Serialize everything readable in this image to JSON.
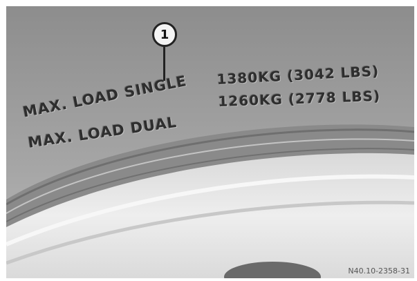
{
  "callout": {
    "number": "1"
  },
  "sidewall": {
    "single_label": "MAX. LOAD SINGLE",
    "single_value": "1380KG (3042 LBS)",
    "dual_label": "MAX. LOAD DUAL",
    "dual_value": "1260KG (2778 LBS)"
  },
  "figure_code": "N40.10-2358-31",
  "colors": {
    "sidewall": "#9a9a9a",
    "rim": "#e4e4e4",
    "text": "#2e2e2e"
  }
}
